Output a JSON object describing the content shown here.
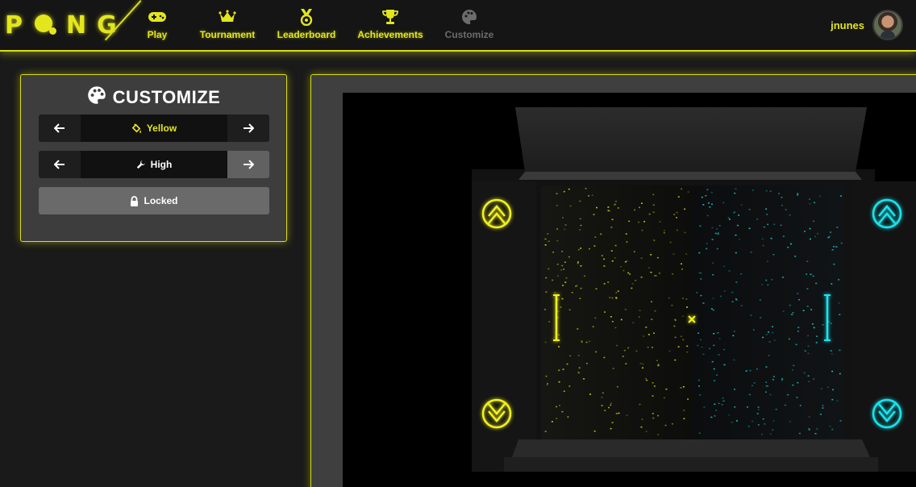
{
  "app": {
    "logo_letters": [
      "P",
      "N",
      "G"
    ]
  },
  "nav": {
    "items": [
      {
        "label": "Play",
        "icon": "gamepad-icon"
      },
      {
        "label": "Tournament",
        "icon": "crown-icon"
      },
      {
        "label": "Leaderboard",
        "icon": "medal-icon"
      },
      {
        "label": "Achievements",
        "icon": "trophy-icon"
      },
      {
        "label": "Customize",
        "icon": "palette-icon"
      }
    ]
  },
  "user": {
    "username": "jnunes"
  },
  "customize": {
    "title": "CUSTOMIZE",
    "color_option": {
      "label": "Yellow",
      "icon": "paint-bucket-icon"
    },
    "quality_option": {
      "label": "High",
      "icon": "wrench-icon"
    },
    "locked_label": "Locked"
  },
  "colors": {
    "accent": "#e3e61c",
    "player_left": "#f2f21c",
    "player_right": "#19e6f0",
    "background": "#1a1a1a",
    "panel": "#3d3d3d"
  }
}
